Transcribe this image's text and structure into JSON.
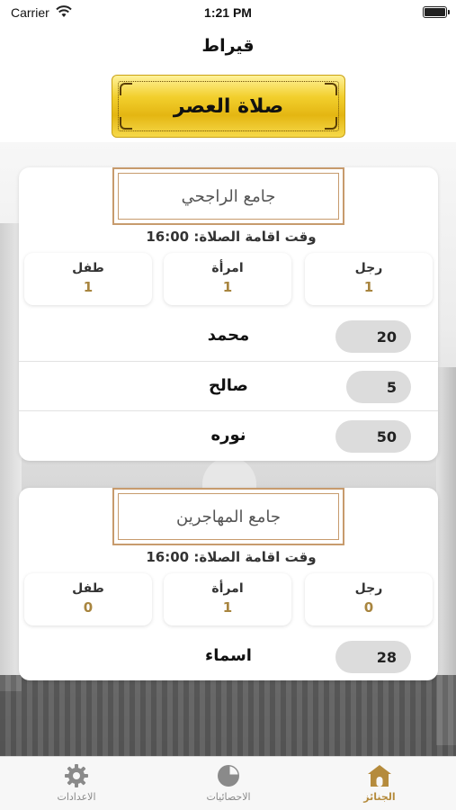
{
  "status_bar": {
    "carrier": "Carrier",
    "time": "1:21 PM"
  },
  "nav": {
    "title": "قيراط"
  },
  "prayer": {
    "name": "صلاة العصر"
  },
  "labels": {
    "prayer_time_prefix": "وقت اقامة الصلاة:",
    "man": "رجل",
    "woman": "امرأة",
    "child": "طفل"
  },
  "mosques": [
    {
      "name": "جامع الراجحي",
      "prayer_time": "16:00",
      "counts": {
        "man": "1",
        "woman": "1",
        "child": "1"
      },
      "people": [
        {
          "name": "محمد",
          "age": "20"
        },
        {
          "name": "صالح",
          "age": "5"
        },
        {
          "name": "نوره",
          "age": "50"
        }
      ]
    },
    {
      "name": "جامع المهاجرين",
      "prayer_time": "16:00",
      "counts": {
        "man": "0",
        "woman": "1",
        "child": "0"
      },
      "people": [
        {
          "name": "اسماء",
          "age": "28"
        }
      ]
    }
  ],
  "tab_bar": {
    "items": [
      {
        "label": "الاعدادات",
        "icon": "gear-icon"
      },
      {
        "label": "الاحصائيات",
        "icon": "pie-chart-icon"
      },
      {
        "label": "الجنائز",
        "icon": "home-icon",
        "active": true
      }
    ]
  },
  "colors": {
    "gold": "#e4b612",
    "accent": "#b58b3c",
    "frame": "#c79b6d"
  }
}
